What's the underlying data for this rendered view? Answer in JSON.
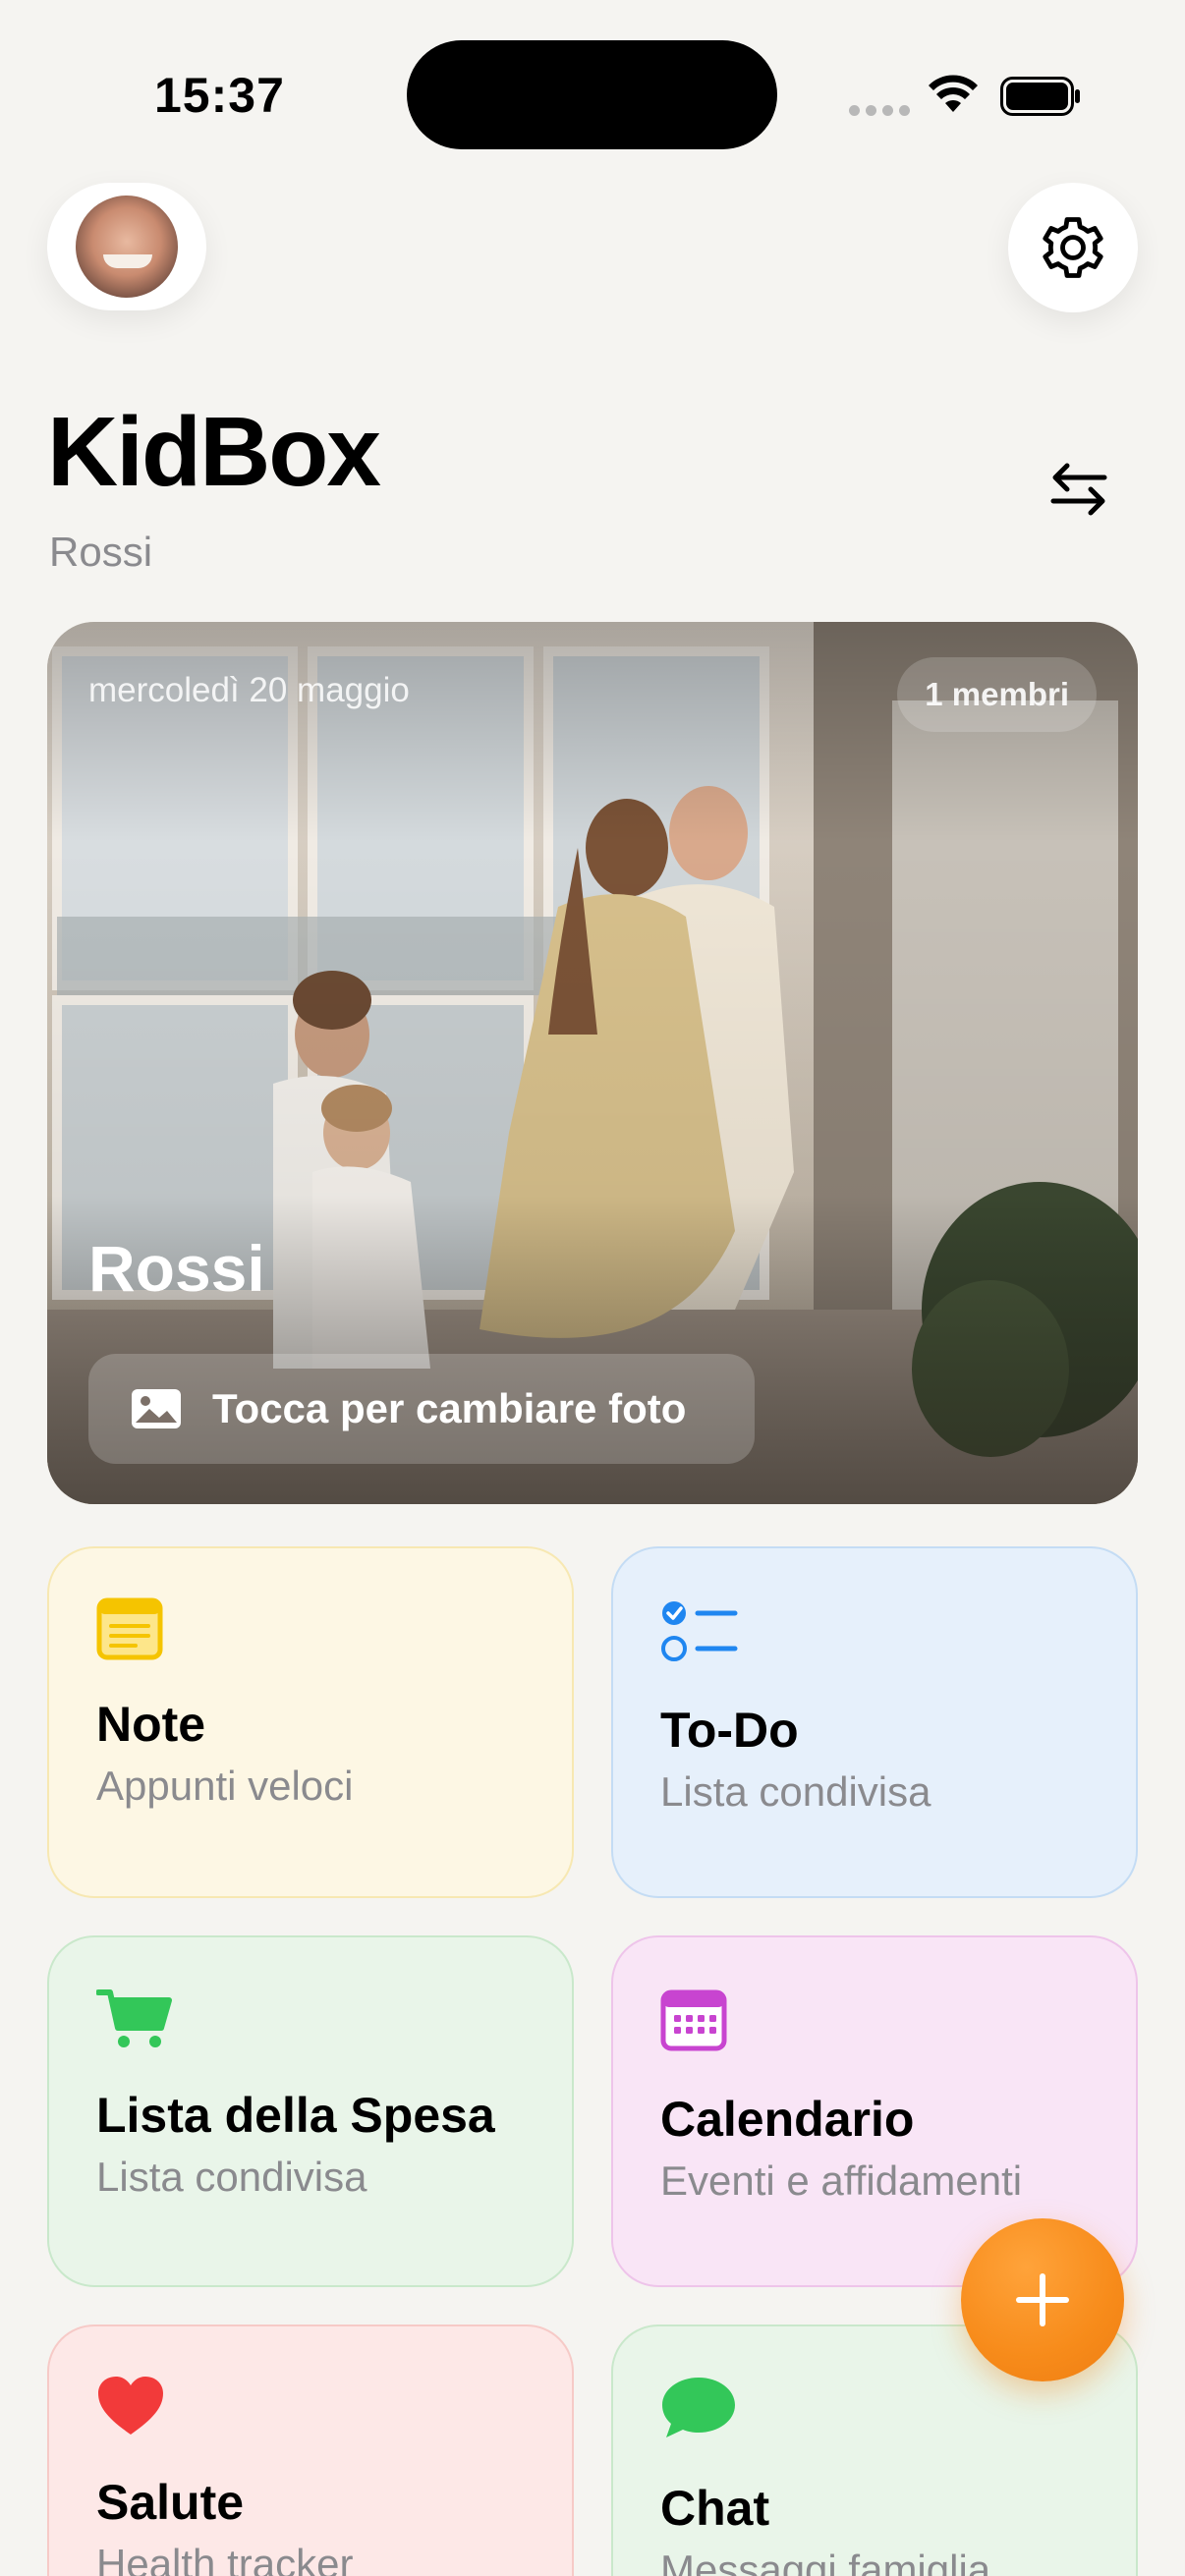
{
  "status_bar": {
    "time": "15:37"
  },
  "header": {
    "app_title": "KidBox",
    "family_name": "Rossi"
  },
  "hero": {
    "date": "mercoledì 20 maggio",
    "members": "1 membri",
    "name": "Rossi",
    "change_photo_label": "Tocca per cambiare foto"
  },
  "tiles": [
    {
      "title": "Note",
      "subtitle": "Appunti veloci",
      "icon": "note-icon",
      "color": "#f5c400"
    },
    {
      "title": "To-Do",
      "subtitle": "Lista condivisa",
      "icon": "checklist-icon",
      "color": "#1f86f0"
    },
    {
      "title": "Lista della Spesa",
      "subtitle": "Lista condivisa",
      "icon": "cart-icon",
      "color": "#33c759"
    },
    {
      "title": "Calendario",
      "subtitle": "Eventi e affidamenti",
      "icon": "calendar-icon",
      "color": "#c844d0"
    },
    {
      "title": "Salute",
      "subtitle": "Health tracker",
      "icon": "heart-icon",
      "color": "#f23a3a"
    },
    {
      "title": "Chat",
      "subtitle": "Messaggi famiglia",
      "icon": "chat-bubble-icon",
      "color": "#33c759"
    }
  ],
  "accent_color": "#f78b1a"
}
